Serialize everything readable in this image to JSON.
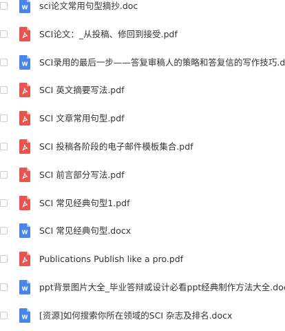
{
  "colors": {
    "word_icon": "#4a86e8",
    "pdf_icon": "#e8554e",
    "text": "#333333",
    "checkbox_border": "#c9cdd4"
  },
  "files": [
    {
      "name": "sci论文常用句型摘抄.doc",
      "type": "word",
      "icon": "word-doc-icon"
    },
    {
      "name": "SCI论文：_从投稿、修回到接受.pdf",
      "type": "pdf",
      "icon": "pdf-icon"
    },
    {
      "name": "SCI录用的最后一步——答复审稿人的策略和答复信的写作技巧.doc",
      "type": "word",
      "icon": "word-doc-icon"
    },
    {
      "name": "SCI 英文摘要写法.pdf",
      "type": "pdf",
      "icon": "pdf-icon"
    },
    {
      "name": "SCI 文章常用句型.pdf",
      "type": "pdf",
      "icon": "pdf-icon"
    },
    {
      "name": "SCI 投稿各阶段的电子邮件模板集合.pdf",
      "type": "pdf",
      "icon": "pdf-icon"
    },
    {
      "name": "SCI 前言部分写法.pdf",
      "type": "pdf",
      "icon": "pdf-icon"
    },
    {
      "name": "SCI 常见经典句型1.pdf",
      "type": "pdf",
      "icon": "pdf-icon"
    },
    {
      "name": "SCI 常见经典句型.docx",
      "type": "word",
      "icon": "word-doc-icon"
    },
    {
      "name": "Publications Publish like a pro.pdf",
      "type": "pdf",
      "icon": "pdf-icon"
    },
    {
      "name": "ppt背景图片大全_毕业答辩或设计必看ppt经典制作方法大全.doc",
      "type": "word",
      "icon": "word-doc-icon"
    },
    {
      "name": "[资源]如何搜索你所在领域的SCI 杂志及排名.docx",
      "type": "word",
      "icon": "word-doc-icon"
    }
  ]
}
